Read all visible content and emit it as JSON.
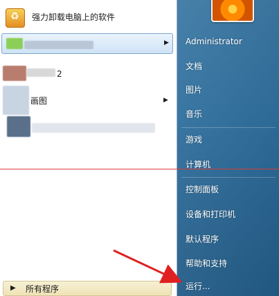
{
  "pinned": {
    "app_label": "强力卸载电脑上的软件"
  },
  "recent": {
    "item2_label": "2",
    "item3_label": "画图"
  },
  "all_programs_label": "所有程序",
  "right_panel": {
    "user": "Administrator",
    "items": [
      "文档",
      "图片",
      "音乐",
      "游戏",
      "计算机",
      "控制面板",
      "设备和打印机",
      "默认程序",
      "帮助和支持",
      "运行..."
    ]
  },
  "colors": {
    "annotation_red": "#e02020"
  }
}
